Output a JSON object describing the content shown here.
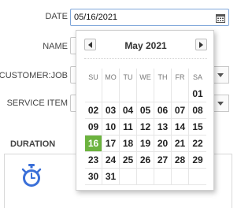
{
  "form": {
    "date_label": "DATE",
    "date_value": "05/16/2021",
    "name_label": "NAME",
    "customer_job_label": "CUSTOMER:JOB",
    "service_item_label": "SERVICE ITEM",
    "duration_label": "DURATION"
  },
  "icons": {
    "date_field": "calendar-icon",
    "duration": "stopwatch-icon",
    "prev": "chevron-left-icon",
    "next": "chevron-right-icon",
    "dropdown": "dropdown-arrow-icon"
  },
  "colors": {
    "selected_day": "#6cb33f",
    "input_border": "#7fa6d9",
    "stopwatch": "#3a6fd8"
  },
  "calendar": {
    "month_title": "May 2021",
    "weekdays": [
      "SU",
      "MO",
      "TU",
      "WE",
      "TH",
      "FR",
      "SA"
    ],
    "weeks": [
      [
        "",
        "",
        "",
        "",
        "",
        "",
        "01"
      ],
      [
        "02",
        "03",
        "04",
        "05",
        "06",
        "07",
        "08"
      ],
      [
        "09",
        "10",
        "11",
        "12",
        "13",
        "14",
        "15"
      ],
      [
        "16",
        "17",
        "18",
        "19",
        "20",
        "21",
        "22"
      ],
      [
        "23",
        "24",
        "25",
        "26",
        "27",
        "28",
        "29"
      ],
      [
        "30",
        "31",
        "",
        "",
        "",
        "",
        ""
      ]
    ],
    "selected_day": "16"
  }
}
